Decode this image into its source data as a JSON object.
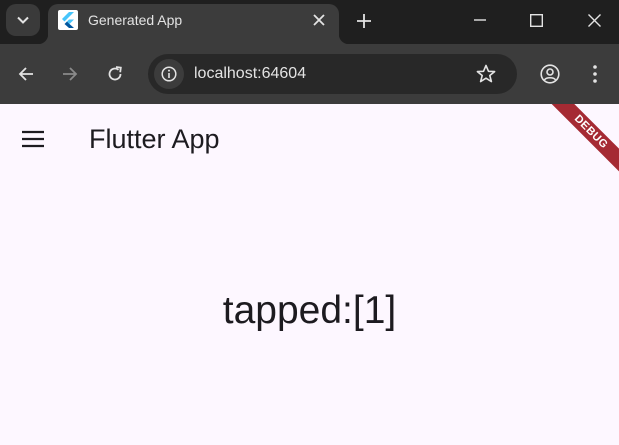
{
  "browser": {
    "tab": {
      "title": "Generated App",
      "favicon": "flutter-logo-icon"
    },
    "url": "localhost:64604",
    "icons": {
      "tab_search": "chevron-down-icon",
      "tab_close": "close-icon",
      "new_tab": "plus-icon",
      "minimize": "minimize-icon",
      "maximize": "maximize-icon",
      "close_window": "close-icon",
      "back": "arrow-left-icon",
      "forward": "arrow-right-icon",
      "reload": "reload-icon",
      "site_info": "info-icon",
      "bookmark": "star-icon",
      "profile": "account-circle-icon",
      "menu": "more-vert-icon"
    },
    "colors": {
      "frame": "#1f1f1f",
      "toolbar": "#3c3c3c",
      "omnibox": "#282828",
      "text": "#e3e3e3"
    }
  },
  "app": {
    "appbar": {
      "title": "Flutter App",
      "menu_icon": "hamburger-menu-icon"
    },
    "body_text": "tapped:[1]",
    "debug_banner": "DEBUG",
    "colors": {
      "background": "#fdf7ff",
      "text": "#1d1b20",
      "banner": "#a52a33"
    }
  }
}
